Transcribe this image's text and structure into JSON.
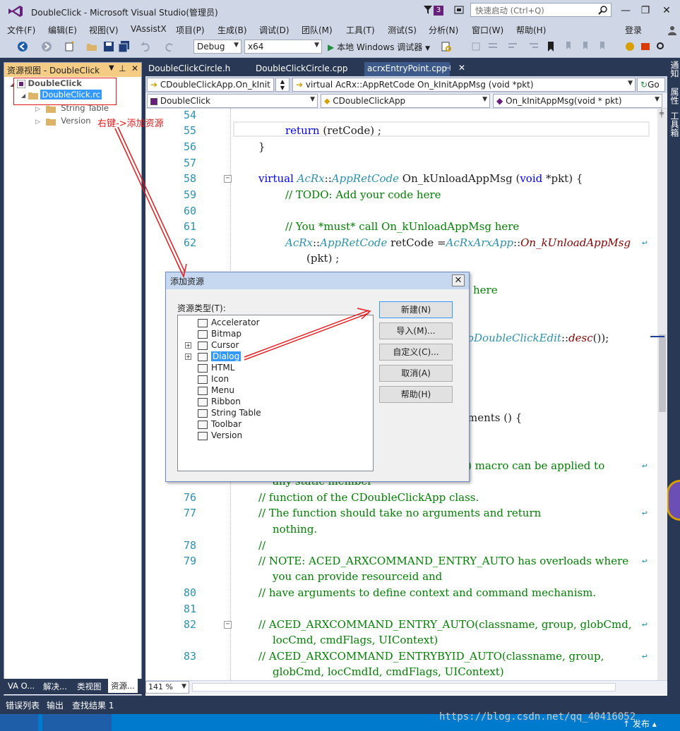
{
  "window": {
    "title": "DoubleClick - Microsoft Visual Studio(管理员)",
    "notification_count": "3",
    "quick_launch_placeholder": "快速启动 (Ctrl+Q)",
    "login": "登录"
  },
  "menu": [
    "文件(F)",
    "编辑(E)",
    "视图(V)",
    "VAssistX",
    "项目(P)",
    "生成(B)",
    "调试(D)",
    "团队(M)",
    "工具(T)",
    "测试(S)",
    "分析(N)",
    "窗口(W)",
    "帮助(H)"
  ],
  "toolbar": {
    "config": "Debug",
    "platform": "x64",
    "run_label": "本地 Windows 调试器"
  },
  "right_rail": [
    "通知",
    "属性",
    "工具箱"
  ],
  "resource_view": {
    "title": "资源视图 - DoubleClick",
    "tree": {
      "root": "DoubleClick",
      "rc_file": "DoubleClick.rc",
      "children": [
        "String Table",
        "Version"
      ]
    },
    "bottom_tabs": [
      "VA O...",
      "解决...",
      "类视图",
      "资源..."
    ]
  },
  "editor": {
    "tabs": [
      "DoubleClickCircle.h",
      "DoubleClickCircle.cpp",
      "acrxEntryPoint.cpp"
    ],
    "nav1_left": "CDoubleClickApp.On_kInit",
    "nav1_right": "virtual AcRx::AppRetCode On_kInitAppMsg (void *pkt)",
    "go_label": "Go",
    "nav2": [
      "DoubleClick",
      "CDoubleClickApp",
      "On_kInitAppMsg(void * pkt)"
    ],
    "zoom": "141 %",
    "lines": [
      {
        "n": "54",
        "t": ""
      },
      {
        "n": "55",
        "t": "return (retCode) ;"
      },
      {
        "n": "56",
        "t": "}"
      },
      {
        "n": "57",
        "t": ""
      },
      {
        "n": "58",
        "t": "virtual AcRx::AppRetCode On_kUnloadAppMsg (void *pkt) {"
      },
      {
        "n": "59",
        "t": "// TODO: Add your code here"
      },
      {
        "n": "60",
        "t": ""
      },
      {
        "n": "61",
        "t": "// You *must* call On_kUnloadAppMsg here"
      },
      {
        "n": "62",
        "t": "AcRx::AppRetCode retCode =AcRxArxApp::On_kUnloadAppMsg"
      },
      {
        "n": "",
        "t": "(pkt) ;"
      },
      {
        "n": "63",
        "t": "here"
      },
      {
        "n": "",
        "t": "oDoubleClickEdit::desc());"
      },
      {
        "n": "",
        "t": "ments () {"
      },
      {
        "n": "",
        "t": ") macro can be applied to"
      },
      {
        "n": "",
        "t": "any static member"
      },
      {
        "n": "76",
        "t": "// function of the CDoubleClickApp class."
      },
      {
        "n": "77",
        "t": "// The function should take no arguments and return"
      },
      {
        "n": "",
        "t": "nothing."
      },
      {
        "n": "78",
        "t": "//"
      },
      {
        "n": "79",
        "t": "// NOTE: ACED_ARXCOMMAND_ENTRY_AUTO has overloads where"
      },
      {
        "n": "",
        "t": "you can provide resourceid and"
      },
      {
        "n": "80",
        "t": "// have arguments to define context and command mechanism."
      },
      {
        "n": "81",
        "t": ""
      },
      {
        "n": "82",
        "t": "// ACED_ARXCOMMAND_ENTRY_AUTO(classname, group, globCmd,"
      },
      {
        "n": "",
        "t": "locCmd, cmdFlags, UIContext)"
      },
      {
        "n": "83",
        "t": "// ACED_ARXCOMMAND_ENTRYBYID_AUTO(classname, group,"
      },
      {
        "n": "",
        "t": "globCmd, locCmdId, cmdFlags, UIContext)"
      }
    ]
  },
  "dialog": {
    "title": "添加资源",
    "list_label": "资源类型(T):",
    "items": [
      "Accelerator",
      "Bitmap",
      "Cursor",
      "Dialog",
      "HTML",
      "Icon",
      "Menu",
      "Ribbon",
      "String Table",
      "Toolbar",
      "Version"
    ],
    "buttons": [
      "新建(N)",
      "导入(M)...",
      "自定义(C)...",
      "取消(A)",
      "帮助(H)"
    ]
  },
  "output_tabs": [
    "错误列表",
    "输出",
    "查找结果 1"
  ],
  "annotation": "右键->添加资源",
  "status": {
    "publish": "发布"
  },
  "watermark": "https://blog.csdn.net/qq_40416052"
}
